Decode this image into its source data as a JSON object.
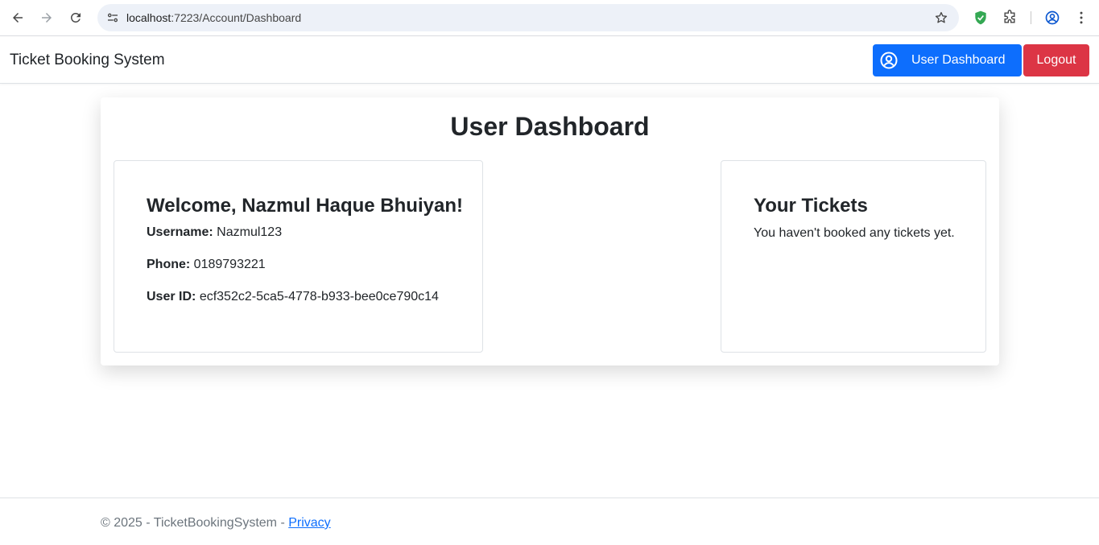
{
  "browser": {
    "url_host": "localhost",
    "url_path": ":7223/Account/Dashboard",
    "icons": [
      "back-arrow-icon",
      "forward-arrow-icon",
      "reload-icon",
      "site-info-icon",
      "star-icon",
      "shield-extension-icon",
      "puzzle-extensions-icon",
      "profile-icon",
      "kebab-menu-icon"
    ]
  },
  "navbar": {
    "brand": "Ticket Booking System",
    "dashboard_button": "User Dashboard",
    "logout_button": "Logout"
  },
  "main": {
    "title": "User Dashboard",
    "user_panel": {
      "welcome": "Welcome, Nazmul Haque Bhuiyan!",
      "username_label": "Username:",
      "username_value": "Nazmul123",
      "phone_label": "Phone:",
      "phone_value": "0189793221",
      "userid_label": "User ID:",
      "userid_value": "ecf352c2-5ca5-4778-b933-bee0ce790c14"
    },
    "tickets_panel": {
      "title": "Your Tickets",
      "message": "You haven't booked any tickets yet."
    }
  },
  "footer": {
    "text": "© 2025 - TicketBookingSystem - ",
    "privacy_link": "Privacy"
  },
  "colors": {
    "primary": "#0d6efd",
    "danger": "#dc3545",
    "text": "#212529",
    "muted": "#6c757d",
    "omnibox": "#edf1f8"
  }
}
